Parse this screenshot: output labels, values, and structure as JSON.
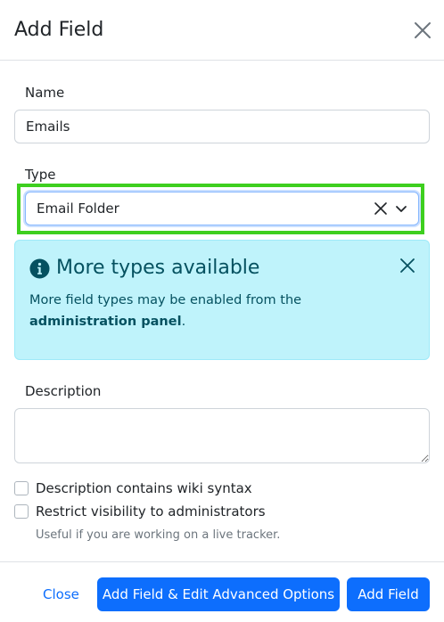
{
  "dialog": {
    "title": "Add Field",
    "close_icon": "close-icon"
  },
  "name": {
    "label": "Name",
    "value": "Emails"
  },
  "type": {
    "label": "Type",
    "selected": "Email Folder",
    "clear_icon": "clear-icon",
    "dropdown_icon": "chevron-down-icon"
  },
  "alert": {
    "icon": "info-icon",
    "title": "More types available",
    "body_text": "More field types may be enabled from the",
    "body_bold": "administration panel",
    "body_end": ".",
    "close_icon": "close-icon"
  },
  "description": {
    "label": "Description",
    "value": ""
  },
  "options": {
    "wiki_syntax_label": "Description contains wiki syntax",
    "wiki_syntax_checked": false,
    "restrict_label": "Restrict visibility to administrators",
    "restrict_checked": false,
    "restrict_help": "Useful if you are working on a live tracker."
  },
  "footer": {
    "close_label": "Close",
    "add_edit_label": "Add Field & Edit Advanced Options",
    "add_label": "Add Field"
  },
  "colors": {
    "primary": "#0d6efd",
    "alert_bg": "#bff3fb",
    "alert_text": "#055160",
    "highlight": "#3ecf1f"
  }
}
